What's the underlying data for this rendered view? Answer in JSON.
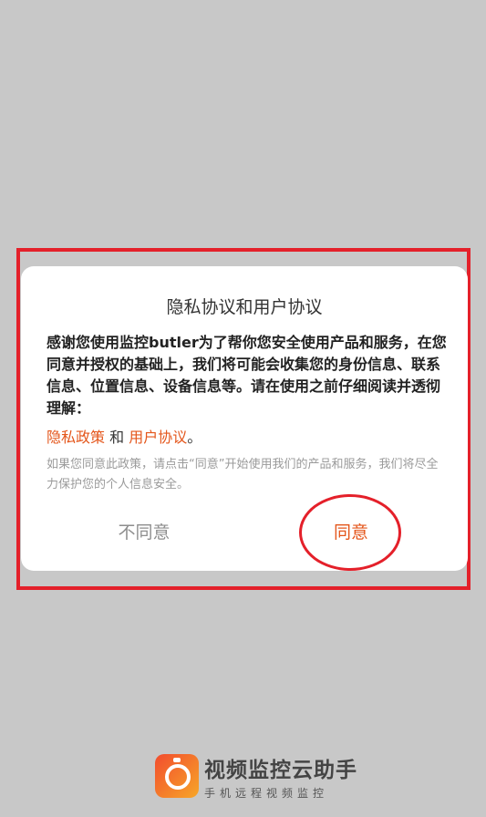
{
  "dialog": {
    "title": "隐私协议和用户协议",
    "body": "感谢您使用监控butler为了帮你您安全使用产品和服务，在您同意并授权的基础上，我们将可能会收集您的身份信息、联系信息、位置信息、设备信息等。请在使用之前仔细阅读并透彻理解：",
    "privacy_link": "隐私政策",
    "and_text": " 和 ",
    "user_link": "用户协议",
    "period": "。",
    "note": "如果您同意此政策，请点击“同意”开始使用我们的产品和服务，我们将尽全力保护您的个人信息安全。",
    "decline_label": "不同意",
    "agree_label": "同意"
  },
  "footer": {
    "app_name": "视频监控云助手",
    "slogan": "手机远程视频监控"
  },
  "colors": {
    "accent": "#e4561b",
    "annotation_red": "#e4202a",
    "backdrop": "#c8c8c8"
  }
}
